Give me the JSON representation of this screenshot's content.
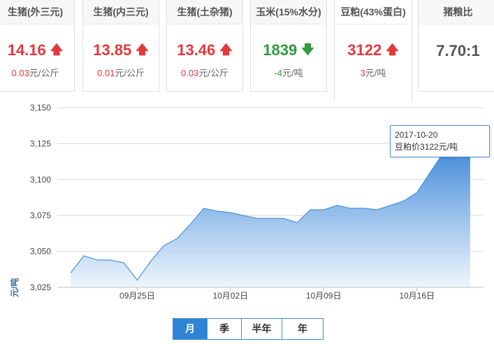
{
  "cards": [
    {
      "name": "生猪(外三元)",
      "price": "14.16",
      "direction": "up",
      "change_value": "0.03",
      "change_unit": "元/公斤"
    },
    {
      "name": "生猪(内三元)",
      "price": "13.85",
      "direction": "up",
      "change_value": "0.01",
      "change_unit": "元/公斤"
    },
    {
      "name": "生猪(土杂猪)",
      "price": "13.46",
      "direction": "up",
      "change_value": "0.03",
      "change_unit": "元/公斤"
    },
    {
      "name": "玉米(15%水分)",
      "price": "1839",
      "direction": "down",
      "change_value": "-4",
      "change_unit": "元/吨"
    },
    {
      "name": "豆粕(43%蛋白)",
      "price": "3122",
      "direction": "up",
      "change_value": "3",
      "change_unit": "元/吨",
      "active": true
    },
    {
      "name": "猪粮比",
      "price": "7.70:1",
      "direction": "flat"
    }
  ],
  "icons": {
    "up": "arrow-up-icon",
    "down": "arrow-down-icon"
  },
  "colors": {
    "up": "#e4393c",
    "down": "#2f9a3e",
    "line": "#4a90d9",
    "area_top": "#2f7fd6",
    "area_bottom": "#eaf3fc"
  },
  "chart_data": {
    "type": "area",
    "ylabel": "元/吨",
    "ylim": [
      3025,
      3150
    ],
    "yticks": [
      "3,025",
      "3,050",
      "3,075",
      "3,100",
      "3,125",
      "3,150"
    ],
    "xlim": [
      "2017-09-19",
      "2017-10-21"
    ],
    "xticks": [
      {
        "date": "2017-09-25",
        "label": "09月25日"
      },
      {
        "date": "2017-10-02",
        "label": "10月02日"
      },
      {
        "date": "2017-10-09",
        "label": "10月09日"
      },
      {
        "date": "2017-10-16",
        "label": "10月16日"
      }
    ],
    "grid": true,
    "series": [
      {
        "x": [
          "2017-09-20",
          "2017-09-21",
          "2017-09-22",
          "2017-09-23",
          "2017-09-24",
          "2017-09-25",
          "2017-09-26",
          "2017-09-27",
          "2017-09-28",
          "2017-09-29",
          "2017-09-30",
          "2017-10-01",
          "2017-10-02",
          "2017-10-03",
          "2017-10-04",
          "2017-10-05",
          "2017-10-06",
          "2017-10-07",
          "2017-10-08",
          "2017-10-09",
          "2017-10-10",
          "2017-10-11",
          "2017-10-12",
          "2017-10-13",
          "2017-10-14",
          "2017-10-15",
          "2017-10-16",
          "2017-10-17",
          "2017-10-18",
          "2017-10-19",
          "2017-10-20"
        ],
        "values": [
          3035,
          3047,
          3044,
          3044,
          3042,
          3030,
          3043,
          3054,
          3059,
          3069,
          3080,
          3078,
          3077,
          3075,
          3073,
          3073,
          3073,
          3070,
          3079,
          3079,
          3082,
          3080,
          3080,
          3079,
          3082,
          3085,
          3091,
          3105,
          3119,
          3126,
          3122
        ]
      }
    ],
    "tooltip": {
      "date": "2017-10-20",
      "label": "豆粕价",
      "value": "3122",
      "unit": "元/吨"
    }
  },
  "range_buttons": [
    {
      "label": "月",
      "active": true
    },
    {
      "label": "季",
      "active": false
    },
    {
      "label": "半年",
      "active": false
    },
    {
      "label": "年",
      "active": false
    }
  ]
}
